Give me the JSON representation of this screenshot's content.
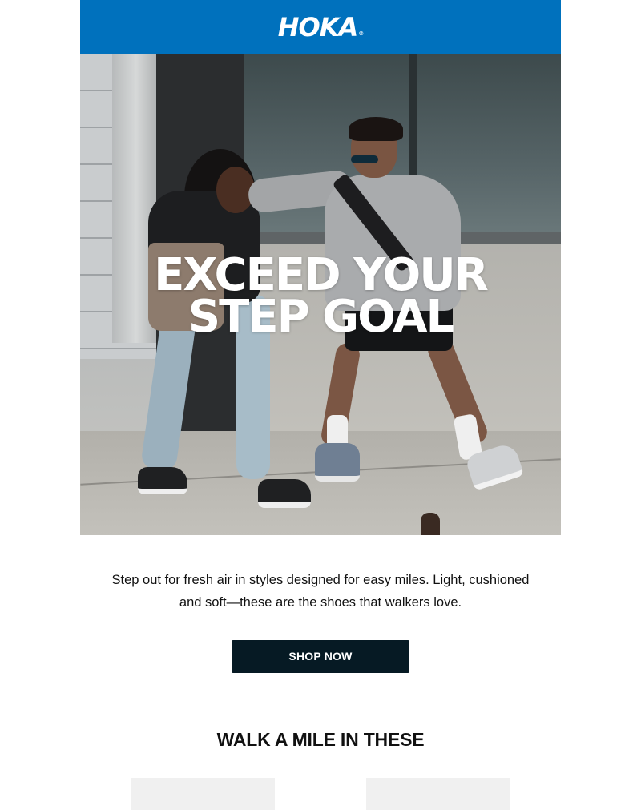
{
  "header": {
    "logo_text": "HOKA",
    "logo_mark": "®",
    "bg_color": "#0071bd"
  },
  "hero": {
    "title_line1": "EXCEED YOUR",
    "title_line2": "STEP GOAL"
  },
  "intro": {
    "text": "Step out for fresh air in styles designed for easy miles. Light, cushioned and soft—these are the shoes that walkers love."
  },
  "cta": {
    "label": "SHOP NOW",
    "bg_color": "#061a24"
  },
  "section": {
    "title": "WALK A MILE IN THESE"
  }
}
